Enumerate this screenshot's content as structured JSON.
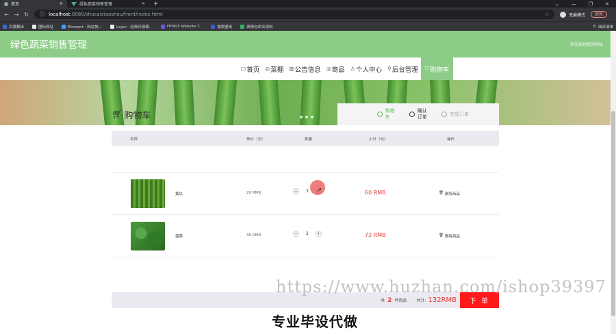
{
  "browser": {
    "tabs": [
      {
        "title": "首页",
        "active": true
      },
      {
        "title": "绿色蔬菜销售管理",
        "active": false
      }
    ],
    "new_tab": "+",
    "url_host": "localhost",
    "url_path": ":8080/shucaixiaoshou/front/index.html",
    "profile_label": "无痕模式",
    "update_label": "更新",
    "bookmarks": [
      "百度翻译",
      "图标网站",
      "Element - 网站快...",
      "Layui - 经典开源模...",
      "HTML5 Website T...",
      "搜索壁纸",
      "表情包命名规则"
    ],
    "bookmarks_right": "阅读清单"
  },
  "site": {
    "title": "绿色蔬菜销售管理",
    "welcome": "欢迎来到我的网站"
  },
  "menu": [
    {
      "icon": "home-icon",
      "glyph": "▢",
      "label": "首页",
      "active": false
    },
    {
      "icon": "shed-icon",
      "glyph": "◎",
      "label": "菜棚",
      "active": false
    },
    {
      "icon": "notice-icon",
      "glyph": "▥",
      "label": "公告信息",
      "active": false
    },
    {
      "icon": "goods-icon",
      "glyph": "◎",
      "label": "商品",
      "active": false
    },
    {
      "icon": "user-icon",
      "glyph": "♙",
      "label": "个人中心",
      "active": false
    },
    {
      "icon": "link-icon",
      "glyph": "⚲",
      "label": "后台管理",
      "active": false
    },
    {
      "icon": "cart-icon",
      "glyph": "⛉",
      "label": "购物车",
      "active": true
    }
  ],
  "cart": {
    "title": "购物车",
    "steps": [
      {
        "label": "购物车",
        "state": "done"
      },
      {
        "label": "确认订单",
        "state": "current"
      },
      {
        "label": "完成订单",
        "state": "pending"
      }
    ],
    "columns": {
      "name": "名称",
      "price": "单价（元）",
      "qty": "数量",
      "subtotal": "小计（元）",
      "action": "操作"
    },
    "rows": [
      {
        "name": "黄瓜",
        "price": "20 RMB",
        "qty": "3",
        "subtotal": "60 RMB",
        "action": "删除商品",
        "thumb_color": "#4f8a2a"
      },
      {
        "name": "菠菜",
        "price": "36 RMB",
        "qty": "2",
        "subtotal": "72 RMB",
        "action": "删除商品",
        "thumb_color": "#3e8e2e"
      }
    ],
    "footer": {
      "prefix": "共",
      "count": "2",
      "suffix": "件商品",
      "sum_label": "共计:",
      "sum": "132RMB",
      "order_button": "下 单"
    }
  },
  "overlay": {
    "watermark": "https://www.huzhan.com/ishop39397",
    "caption": "专业毕设代做"
  }
}
